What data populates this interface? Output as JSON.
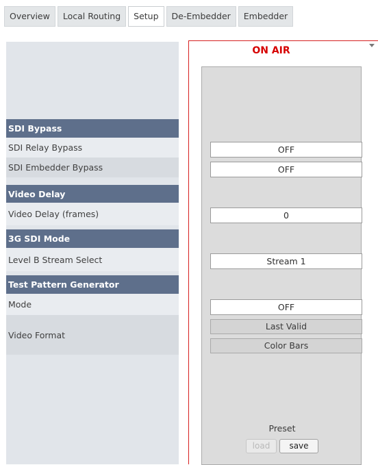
{
  "tabs": [
    {
      "label": "Overview",
      "active": false
    },
    {
      "label": "Local Routing",
      "active": false
    },
    {
      "label": "Setup",
      "active": true
    },
    {
      "label": "De-Embedder",
      "active": false
    },
    {
      "label": "Embedder",
      "active": false
    }
  ],
  "sections": {
    "sdi_bypass": {
      "title": "SDI Bypass",
      "relay_bypass_label": "SDI Relay Bypass",
      "embedder_bypass_label": "SDI Embedder Bypass"
    },
    "video_delay": {
      "title": "Video Delay",
      "frames_label": "Video Delay (frames)"
    },
    "sdi_3g_mode": {
      "title": "3G SDI Mode",
      "level_b_label": "Level B Stream Select"
    },
    "test_pattern": {
      "title": "Test Pattern Generator",
      "mode_label": "Mode",
      "video_format_label": "Video Format"
    }
  },
  "panel": {
    "status": "ON AIR",
    "status_color": "#d60000",
    "relay_bypass_value": "OFF",
    "embedder_bypass_value": "OFF",
    "video_delay_value": "0",
    "level_b_value": "Stream 1",
    "tpg_mode_value": "OFF",
    "video_format_options": [
      "Last Valid",
      "Color Bars"
    ],
    "preset_label": "Preset",
    "load_label": "load",
    "save_label": "save"
  },
  "colors": {
    "header_bg": "#5e6f8b",
    "accent_red": "#d61f1f"
  }
}
